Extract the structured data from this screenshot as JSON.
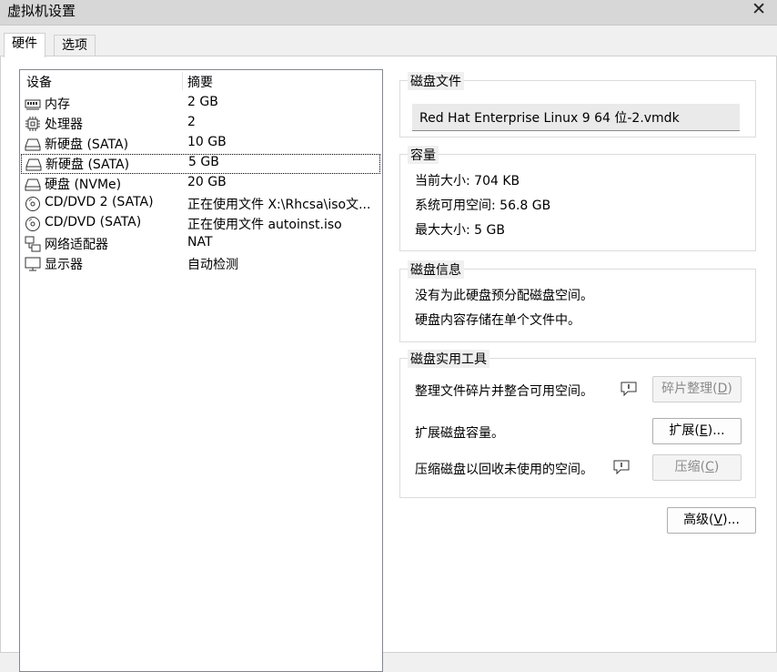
{
  "window": {
    "title": "虚拟机设置",
    "close_glyph": "✕"
  },
  "tabs": [
    {
      "label": "硬件",
      "active": true
    },
    {
      "label": "选项",
      "active": false
    }
  ],
  "device_list": {
    "headers": {
      "device": "设备",
      "summary": "摘要"
    },
    "rows": [
      {
        "icon": "memory-icon",
        "name": "内存",
        "summary": "2 GB"
      },
      {
        "icon": "cpu-icon",
        "name": "处理器",
        "summary": "2"
      },
      {
        "icon": "hard-disk-icon",
        "name": "新硬盘 (SATA)",
        "summary": "10 GB"
      },
      {
        "icon": "hard-disk-icon",
        "name": "新硬盘 (SATA)",
        "summary": "5 GB",
        "selected": true
      },
      {
        "icon": "hard-disk-icon",
        "name": "硬盘 (NVMe)",
        "summary": "20 GB"
      },
      {
        "icon": "cd-dvd-icon",
        "name": "CD/DVD 2 (SATA)",
        "summary": "正在使用文件 X:\\Rhcsa\\iso文..."
      },
      {
        "icon": "cd-dvd-icon",
        "name": "CD/DVD (SATA)",
        "summary": "正在使用文件 autoinst.iso"
      },
      {
        "icon": "network-adapter-icon",
        "name": "网络适配器",
        "summary": "NAT"
      },
      {
        "icon": "display-icon",
        "name": "显示器",
        "summary": "自动检测"
      }
    ]
  },
  "disk_file": {
    "title": "磁盘文件",
    "value": "Red Hat Enterprise Linux 9 64 位-2.vmdk"
  },
  "capacity": {
    "title": "容量",
    "current_size": "当前大小: 704 KB",
    "system_free": "系统可用空间: 56.8 GB",
    "max_size": "最大大小: 5 GB"
  },
  "disk_info": {
    "title": "磁盘信息",
    "line1": "没有为此硬盘预分配磁盘空间。",
    "line2": "硬盘内容存储在单个文件中。"
  },
  "disk_utilities": {
    "title": "磁盘实用工具",
    "defrag_text": "整理文件碎片并整合可用空间。",
    "defrag_button": {
      "text": "碎片整理(",
      "key": "D",
      "tail": ")",
      "enabled": false
    },
    "expand_text": "扩展磁盘容量。",
    "expand_button": {
      "text": "扩展(",
      "key": "E",
      "tail": ")...",
      "enabled": true
    },
    "compact_text": "压缩磁盘以回收未使用的空间。",
    "compact_button": {
      "text": "压缩(",
      "key": "C",
      "tail": ")",
      "enabled": false
    }
  },
  "advanced_button": {
    "text": "高级(",
    "key": "V",
    "tail": ")...",
    "enabled": true
  },
  "colors": {
    "selection_outline": "#000000",
    "disabled_text": "#8a8a8a",
    "titlebar_bg": "#d7d7d7"
  }
}
